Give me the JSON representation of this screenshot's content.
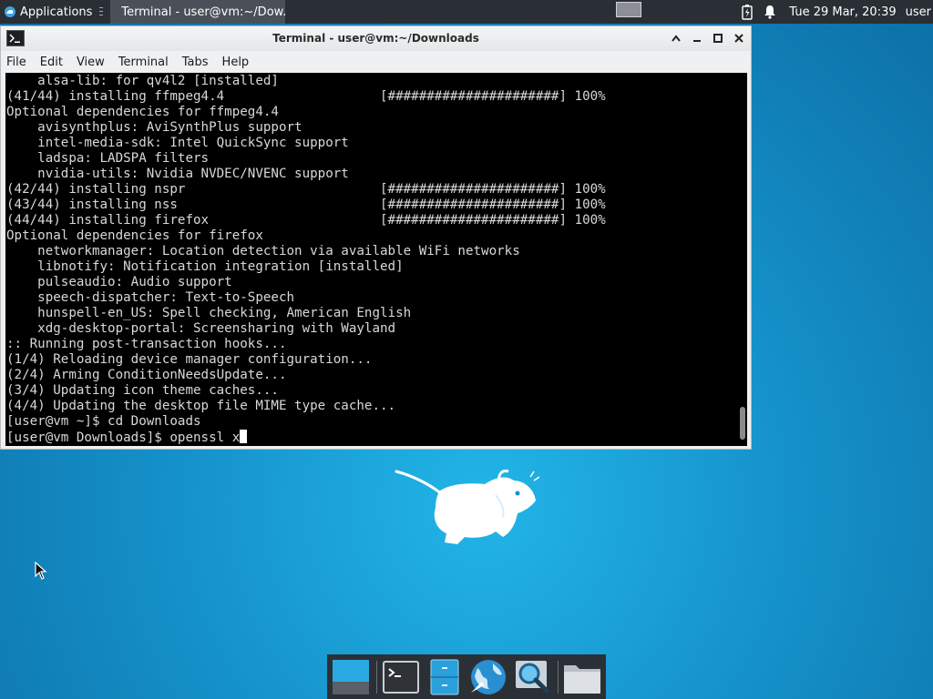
{
  "top_panel": {
    "applications_label": "Applications",
    "taskbar_window_label": "Terminal - user@vm:~/Dow...",
    "clock": "Tue 29 Mar, 20:39",
    "user": "user"
  },
  "terminal": {
    "title": "Terminal - user@vm:~/Downloads",
    "menu": [
      "File",
      "Edit",
      "View",
      "Terminal",
      "Tabs",
      "Help"
    ],
    "lines": [
      "    alsa-lib: for qv4l2 [installed]",
      "(41/44) installing ffmpeg4.4                    [######################] 100%",
      "Optional dependencies for ffmpeg4.4",
      "    avisynthplus: AviSynthPlus support",
      "    intel-media-sdk: Intel QuickSync support",
      "    ladspa: LADSPA filters",
      "    nvidia-utils: Nvidia NVDEC/NVENC support",
      "(42/44) installing nspr                         [######################] 100%",
      "(43/44) installing nss                          [######################] 100%",
      "(44/44) installing firefox                      [######################] 100%",
      "Optional dependencies for firefox",
      "    networkmanager: Location detection via available WiFi networks",
      "    libnotify: Notification integration [installed]",
      "    pulseaudio: Audio support",
      "    speech-dispatcher: Text-to-Speech",
      "    hunspell-en_US: Spell checking, American English",
      "    xdg-desktop-portal: Screensharing with Wayland",
      ":: Running post-transaction hooks...",
      "(1/4) Reloading device manager configuration...",
      "(2/4) Arming ConditionNeedsUpdate...",
      "(3/4) Updating icon theme caches...",
      "(4/4) Updating the desktop file MIME type cache...",
      "[user@vm ~]$ cd Downloads"
    ],
    "prompt_line": "[user@vm Downloads]$ openssl x"
  },
  "dock": {
    "items": [
      "show-desktop",
      "terminal",
      "file-manager",
      "web-browser",
      "app-finder",
      "home-folder"
    ]
  },
  "colors": {
    "panel_bg": "#2a2f35",
    "terminal_bg": "#000000",
    "terminal_fg": "#d8d8d8",
    "desktop_accent": "#1591c9"
  }
}
